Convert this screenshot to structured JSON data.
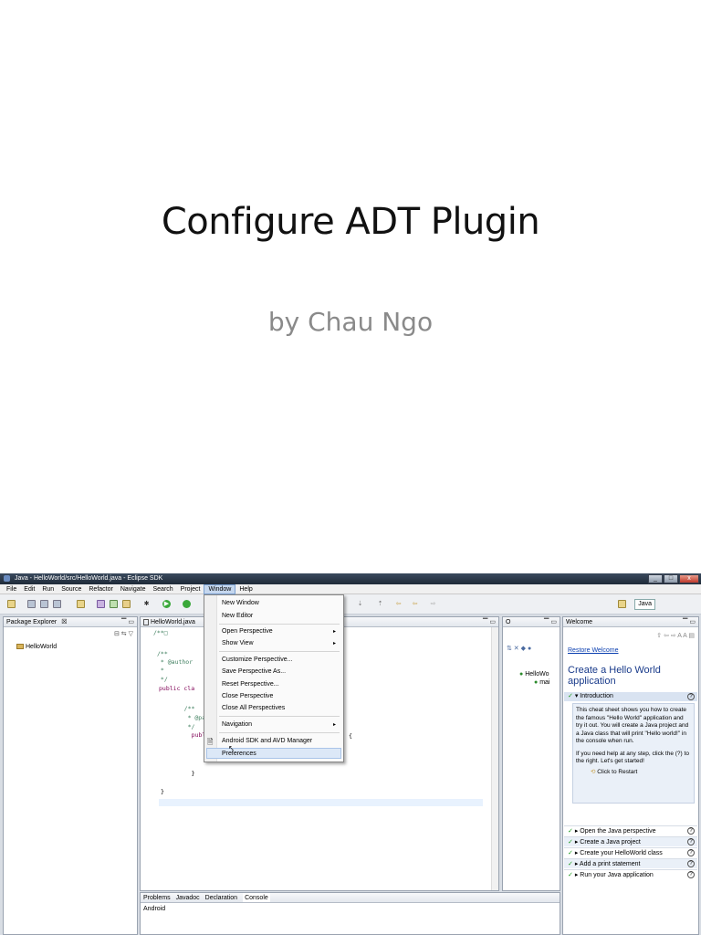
{
  "slide": {
    "title": "Configure ADT Plugin",
    "subtitle": "by Chau Ngo"
  },
  "window": {
    "title": "Java - HelloWorld/src/HelloWorld.java - Eclipse SDK",
    "controls": [
      "_",
      "□",
      "x"
    ]
  },
  "menubar": {
    "items": [
      "File",
      "Edit",
      "Run",
      "Source",
      "Refactor",
      "Navigate",
      "Search",
      "Project",
      "Window",
      "Help"
    ],
    "active": "Window"
  },
  "toolbar": {
    "perspective_label": "Java"
  },
  "package_explorer": {
    "tab_label": "Package Explorer",
    "tab_close": "☒",
    "items": [
      "HelloWorld"
    ]
  },
  "editor": {
    "tab_label": "HelloWorld.java",
    "lines": [
      "/**□",
      "",
      "/**",
      " * @author",
      " *",
      " */",
      "public cla",
      "",
      "    /**",
      "     * @pa",
      "     */",
      "    public",
      "        //",
      "        Sy",
      "",
      "    }",
      "",
      "}"
    ],
    "brace_fragment": "{"
  },
  "window_menu": {
    "items": [
      {
        "label": "New Window",
        "submenu": false
      },
      {
        "label": "New Editor",
        "submenu": false
      },
      {
        "label": "Open Perspective",
        "submenu": true
      },
      {
        "label": "Show View",
        "submenu": true
      },
      {
        "label": "Customize Perspective...",
        "submenu": false
      },
      {
        "label": "Save Perspective As...",
        "submenu": false
      },
      {
        "label": "Reset Perspective...",
        "submenu": false
      },
      {
        "label": "Close Perspective",
        "submenu": false
      },
      {
        "label": "Close All Perspectives",
        "submenu": false
      },
      {
        "label": "Navigation",
        "submenu": true
      },
      {
        "label": "Android SDK and AVD Manager",
        "submenu": false
      },
      {
        "label": "Preferences",
        "submenu": false
      }
    ]
  },
  "outline": {
    "tab_label": "O",
    "items": [
      "HelloWo",
      "mai"
    ]
  },
  "welcome": {
    "tab_label": "Welcome",
    "restore_link": "Restore Welcome",
    "heading": "Create a Hello World application",
    "intro_label": "Introduction",
    "intro_text": "This cheat sheet shows you how to create the famous \"Hello World\" application and try it out. You will create a Java project and a Java class that will print \"Hello world!\" in the console when run.",
    "help_text": "If you need help at any step, click the (?) to the right. Let's get started!",
    "restart_label": "Click to Restart",
    "steps": [
      "Open the Java perspective",
      "Create a Java project",
      "Create your HelloWorld class",
      "Add a print statement",
      "Run your Java application"
    ]
  },
  "bottom_panel": {
    "tabs": [
      "Problems",
      "Javadoc",
      "Declaration",
      "Console"
    ],
    "active_tab": "Console",
    "console_label": "Android"
  },
  "colors": {
    "accent": "#183a8a",
    "menu_highlight": "#dce8f7",
    "check": "#1a9a1a"
  }
}
